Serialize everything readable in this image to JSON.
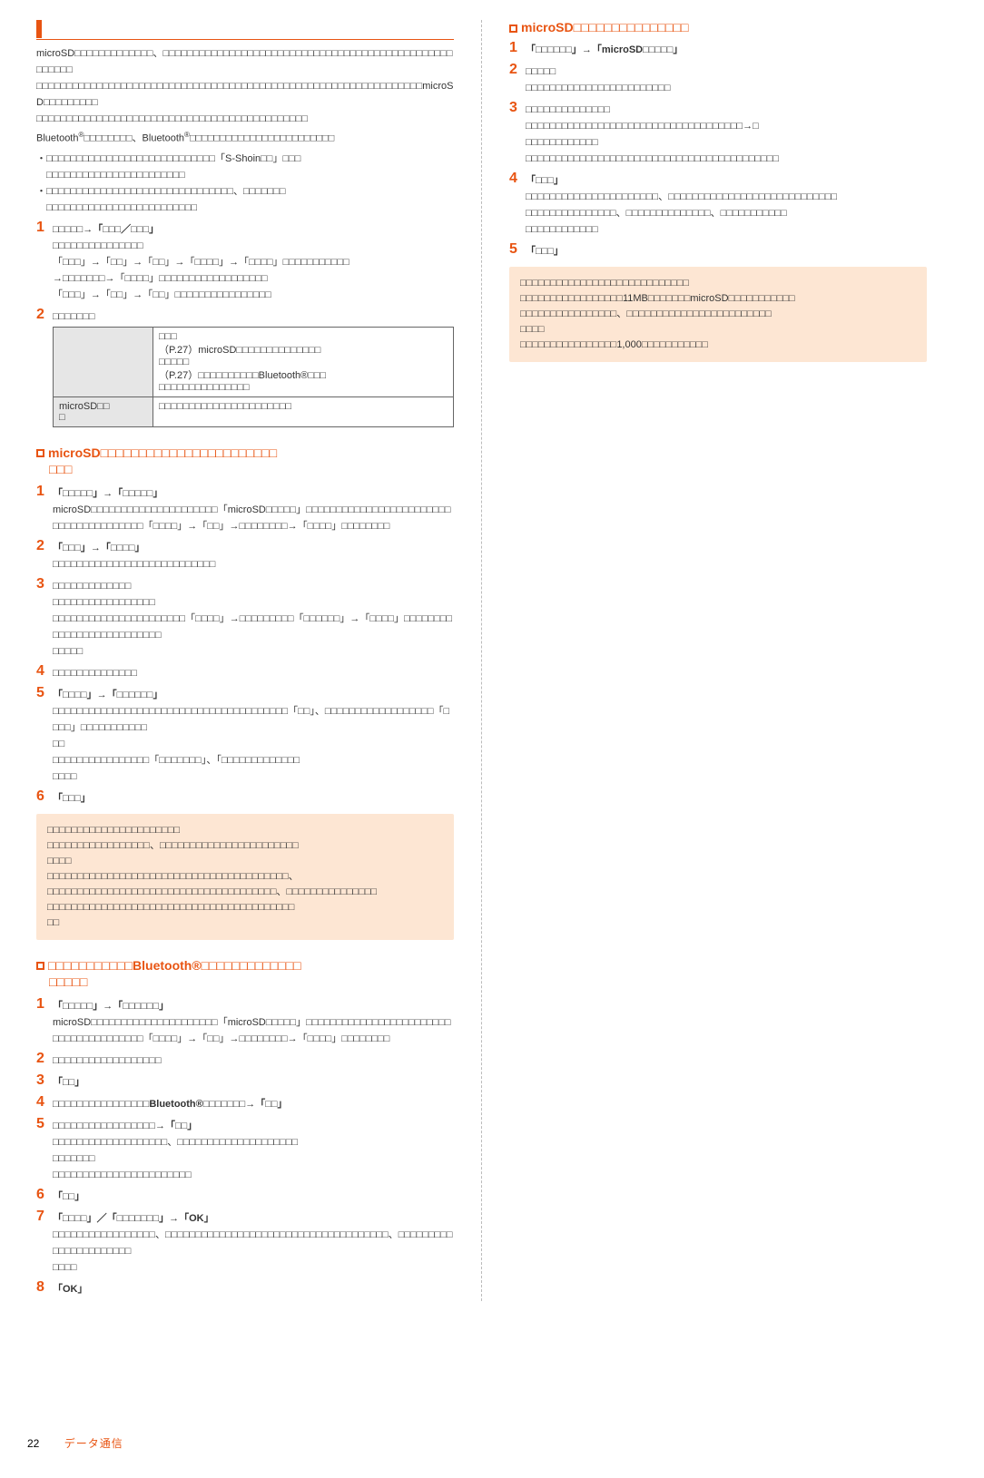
{
  "page_number": "22",
  "footer_label": "データ通信",
  "left": {
    "main_title_squares": 12,
    "intro_text": "microSD□□□□□□□□□□□□□□□□□□□□□□□□□□□□□□□□□□□ ... microSD□□□□□□□□□ ... Bluetooth®□□□□□□□□、Bluetooth®□□□□□□□□□□□□□□□□□□□□□□□□□",
    "dot_notes": [
      "□□□□□□□□□□□□□□□□□□□□□□□□□□□S-Shoin□□□ □□□□□□□□□□□□□□□□□□□□□□□",
      "□□□□□□□□□□□□□□□□□□□□□□□□□□□□□□□□□□□□"
    ],
    "step1_title": "□□□□□□",
    "step1_lines": [
      "□□□□□□□□□□□□□□□→□□□□□→□□□□□→□□□→□□□→□□□□□",
      "→□□□□□□□→□□□□□□□□□□□□□□□□□□□□□□",
      "□□□□□□→□□□→□□□→□□□□□□□□□□□□□□□□"
    ],
    "table": {
      "rows": [
        {
          "h": "",
          "c": "□□□\n（P.27）microSD□□□□□□□□□□□□□□\n□□□□□\n（P.27）□□□□□□□□□□Bluetooth®□□□□□□□□□□□□□□□□□□"
        },
        {
          "h": "microSD□□□□",
          "c": "□□□□□□□□□□□□□□□□□□□□□□"
        }
      ],
      "p27": "P.27",
      "bt": "Bluetooth®",
      "msd": "microSD"
    },
    "section_b_title": "microSD",
    "stepB1_msd": "microSD",
    "sectionC_title_mid": "Bluetooth®",
    "stepC4_bt": "Bluetooth®",
    "stepC7_ok": "OK",
    "stepC8_ok": "OK",
    "text_msd": "microSD"
  },
  "right": {
    "section_title": "microSD",
    "step1_mid": "microSD",
    "note_11mb": "11MB",
    "note_msd": "microSD",
    "note_1000": "1,000"
  }
}
